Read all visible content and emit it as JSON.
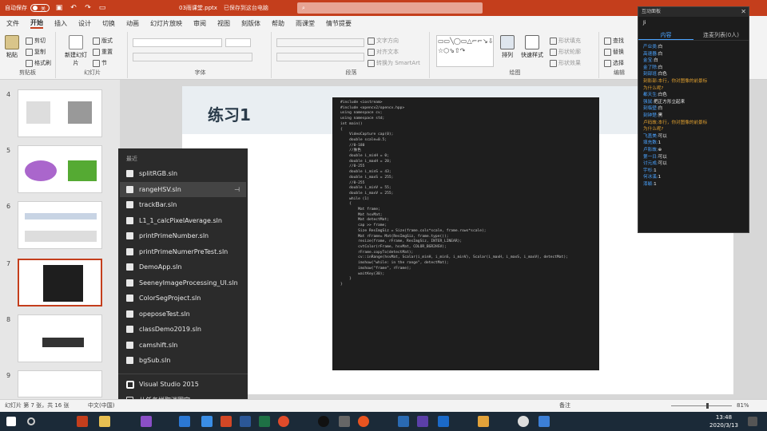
{
  "titlebar": {
    "autosave_label": "自动保存",
    "autosave_state": "关",
    "document_title": "03雨课堂.pptx",
    "document_status": "已保存到这台电脑",
    "search_placeholder": ""
  },
  "tabs": [
    "文件",
    "开始",
    "插入",
    "设计",
    "切换",
    "动画",
    "幻灯片放映",
    "审阅",
    "视图",
    "刻版体",
    "帮助",
    "雨课堂",
    "情节提要"
  ],
  "active_tab": "开始",
  "ribbon": {
    "clipboard": {
      "label": "剪贴板",
      "paste": "粘贴",
      "cut": "剪切",
      "copy": "复制",
      "format_painter": "格式刷"
    },
    "slides": {
      "label": "幻灯片",
      "new_slide": "新建幻灯片",
      "layout": "版式",
      "reset": "重置",
      "section": "节"
    },
    "font": {
      "label": "字体"
    },
    "paragraph": {
      "label": "段落",
      "text_direction": "文字方向",
      "align_text": "对齐文本",
      "smartart": "转换为 SmartArt"
    },
    "drawing": {
      "label": "绘图",
      "arrange": "排列",
      "quick_styles": "快速样式",
      "shape_fill": "形状填充",
      "shape_outline": "形状轮廓",
      "shape_effects": "形状效果"
    },
    "editing": {
      "label": "编辑",
      "find": "查找",
      "replace": "替换",
      "select": "选择"
    },
    "shape_glyphs": "▭▭╲◯▭△⌐⌐↘⇩⇨↻↺{}☆⬡⇘⇧↷"
  },
  "slide_numbers": [
    "4",
    "5",
    "6",
    "7",
    "8",
    "9"
  ],
  "slide": {
    "title": "练习1",
    "code_lines": [
      "#include <iostream>",
      "#include <opencv2/opencv.hpp>",
      "using namespace cv;",
      "using namespace std;",
      "",
      "int main()",
      "{",
      "    VideoCapture cap(0);",
      "",
      "    double scale=0.5;",
      "",
      "    //0-180",
      "    //肤色",
      "    double i_minH = 0;",
      "    double i_maxH = 20;",
      "    //0-255",
      "    double i_minS = 43;",
      "    double i_maxS = 255;",
      "    //0-255",
      "    double i_minV = 55;",
      "    double i_maxV = 255;",
      "",
      "    while (1)",
      "    {",
      "        Mat frame;",
      "        Mat hsvMat;",
      "        Mat detectMat;",
      "",
      "        cap >> frame;",
      "        Size ResImgSiz = Size(frame.cols*scale, frame.rows*scale);",
      "        Mat rFrame= Mat(ResImgSiz, frame.type());",
      "        resize(frame, rFrame, ResImgSiz, INTER_LINEAR);",
      "",
      "        cvtColor(rFrame, hsvMat, COLOR_BGR2HSV);",
      "",
      "        rFrame.copyTo(detectMat);",
      "",
      "        cv::inRange(hsvMat, Scalar(i_minH, i_minS, i_minV), Scalar(i_maxH, i_maxS, i_maxV), detectMat);",
      "",
      "        imshow(\"while: in the range\", detectMat);",
      "        imshow(\"frame\", rFrame);",
      "",
      "        waitKey(30);",
      "    }",
      "}"
    ]
  },
  "jumplist": {
    "header": "最近",
    "items": [
      "splitRGB.sln",
      "rangeHSV.sln",
      "trackBar.sln",
      "L1_1_calcPixelAverage.sln",
      "printPrimeNumber.sln",
      "printPrimeNumerPreTest.sln",
      "DemoApp.sln",
      "SeeneyImageProcessing_UI.sln",
      "ColorSegProject.sln",
      "opeposeTest.sln",
      "classDemo2019.sln",
      "camshift.sln",
      "bgSub.sln"
    ],
    "hovered_index": 1,
    "app_name": "Visual Studio 2015",
    "unpin_label": "从任务栏取消固定"
  },
  "interaction_panel": {
    "title": "互动面板",
    "user_initial": "Ji",
    "tab_content": "内容",
    "tab_list": "连麦列表(0人)",
    "rows": [
      {
        "key": "产业类:",
        "val": "白",
        "warn": false
      },
      {
        "key": "高速器:",
        "val": "白",
        "warn": false
      },
      {
        "key": "金宝:",
        "val": "白",
        "warn": false
      },
      {
        "key": "金了除:",
        "val": "白",
        "warn": false
      },
      {
        "key": "刻部班:",
        "val": "白色",
        "warn": false
      },
      {
        "key": "刻影部:",
        "val": "本行，你对图像的前景标",
        "warn": true
      },
      {
        "key": "",
        "val": "为什么呢?",
        "warn": true
      },
      {
        "key": "都天生:",
        "val": "白色",
        "warn": false
      },
      {
        "key": "强鼠:",
        "val": "把正方形立起来",
        "warn": false
      },
      {
        "key": "刻临壁:",
        "val": "白",
        "warn": false
      },
      {
        "key": "刻钟楚:",
        "val": "黑",
        "warn": false
      },
      {
        "key": "卢码故:",
        "val": "本行，你对图像的前景标",
        "warn": true
      },
      {
        "key": "",
        "val": "为什么呢?",
        "warn": true
      },
      {
        "key": "飞盖美:",
        "val": "可以",
        "warn": false
      },
      {
        "key": "填充数:",
        "val": "1",
        "warn": false
      },
      {
        "key": "卢影故:",
        "val": "⊕",
        "warn": false
      },
      {
        "key": "第一日:",
        "val": "可以",
        "warn": false
      },
      {
        "key": "讨元成:",
        "val": "可以",
        "warn": false
      },
      {
        "key": "宇杉:",
        "val": "1",
        "warn": false
      },
      {
        "key": "何冰溪:",
        "val": "1",
        "warn": false
      },
      {
        "key": "漆颖:",
        "val": "1",
        "warn": false
      }
    ]
  },
  "statusbar": {
    "slide_info": "幻灯片 第 7 张，共 16 张",
    "language": "中文(中国)",
    "notes": "备注",
    "zoom": "81%"
  },
  "taskbar": {
    "time": "13:48",
    "date": "2020/3/13"
  }
}
